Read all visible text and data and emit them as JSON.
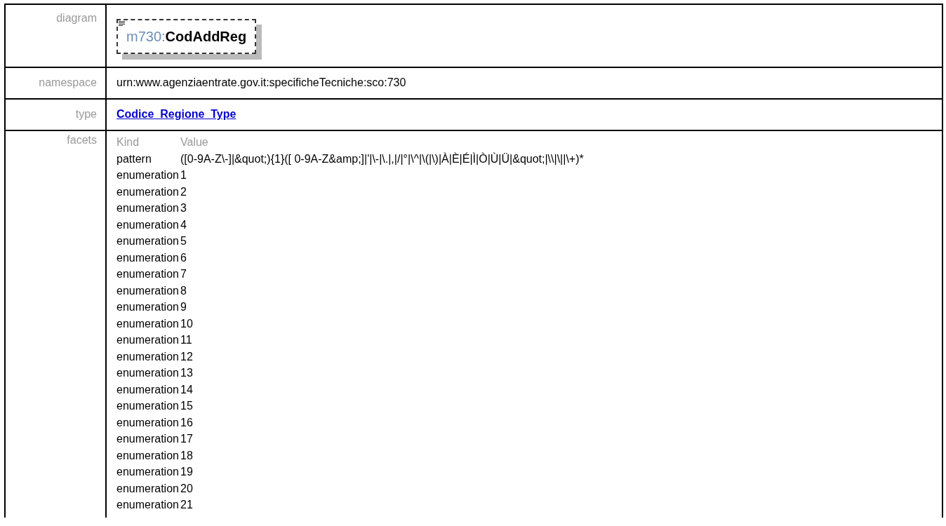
{
  "rows": [
    {
      "kind": "diagram",
      "label": "diagram",
      "element": {
        "prefix": "m730:",
        "name": "CodAddReg"
      }
    },
    {
      "kind": "text",
      "label": "namespace",
      "value": "urn:www.agenziaentrate.gov.it:specificheTecniche:sco:730"
    },
    {
      "kind": "link",
      "label": "type",
      "value": "Codice_Regione_Type"
    },
    {
      "kind": "facets",
      "label": "facets",
      "columns": [
        "Kind",
        "Value"
      ],
      "items": [
        {
          "facet": "pattern",
          "value": "([0-9A-Z\\-]|&quot;){1}([ 0-9A-Z&amp;]|'|\\-|\\.|,|/|°|\\^|\\(|\\)|À|È|É|Ì|Ò|Ù|Ü|&quot;|\\\\|\\||\\+)*"
        },
        {
          "facet": "enumeration",
          "value": "1"
        },
        {
          "facet": "enumeration",
          "value": "2"
        },
        {
          "facet": "enumeration",
          "value": "3"
        },
        {
          "facet": "enumeration",
          "value": "4"
        },
        {
          "facet": "enumeration",
          "value": "5"
        },
        {
          "facet": "enumeration",
          "value": "6"
        },
        {
          "facet": "enumeration",
          "value": "7"
        },
        {
          "facet": "enumeration",
          "value": "8"
        },
        {
          "facet": "enumeration",
          "value": "9"
        },
        {
          "facet": "enumeration",
          "value": "10"
        },
        {
          "facet": "enumeration",
          "value": "11"
        },
        {
          "facet": "enumeration",
          "value": "12"
        },
        {
          "facet": "enumeration",
          "value": "13"
        },
        {
          "facet": "enumeration",
          "value": "14"
        },
        {
          "facet": "enumeration",
          "value": "15"
        },
        {
          "facet": "enumeration",
          "value": "16"
        },
        {
          "facet": "enumeration",
          "value": "17"
        },
        {
          "facet": "enumeration",
          "value": "18"
        },
        {
          "facet": "enumeration",
          "value": "19"
        },
        {
          "facet": "enumeration",
          "value": "20"
        },
        {
          "facet": "enumeration",
          "value": "21"
        }
      ]
    }
  ]
}
